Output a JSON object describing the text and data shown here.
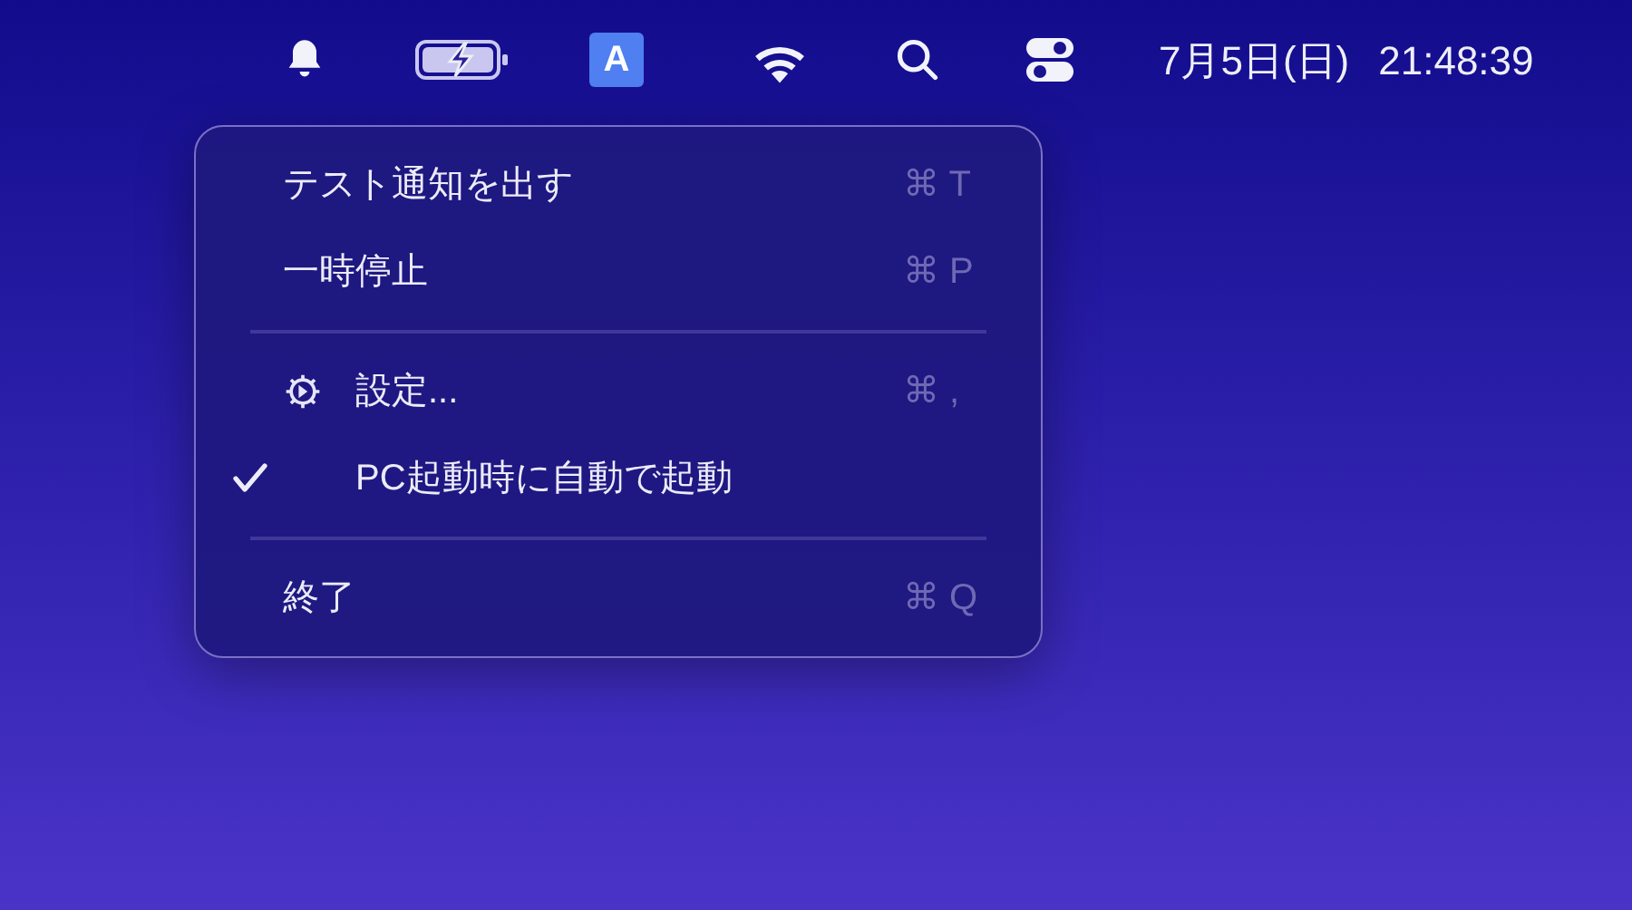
{
  "menu_bar": {
    "input_source": "A",
    "date": "7月5日(日)",
    "time": "21:48:39"
  },
  "menu": {
    "items": [
      {
        "kind": "item",
        "label": "テスト通知を出す",
        "shortcut": "⌘ T",
        "checked": false
      },
      {
        "kind": "item",
        "label": "一時停止",
        "shortcut": "⌘ P",
        "checked": false
      },
      {
        "kind": "separator"
      },
      {
        "kind": "settings",
        "label": "設定...",
        "shortcut": "⌘ ,",
        "checked": false
      },
      {
        "kind": "item",
        "label": "PC起動時に自動で起動",
        "checked": true
      },
      {
        "kind": "separator"
      },
      {
        "kind": "item",
        "label": "終了",
        "shortcut": "⌘ Q",
        "checked": false
      }
    ]
  }
}
